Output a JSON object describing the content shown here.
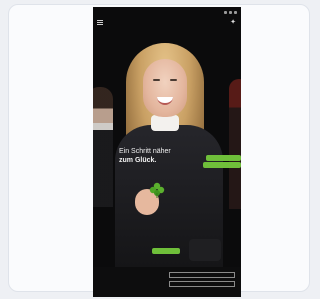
{
  "app": {
    "status_bar": {
      "time": "",
      "battery": ""
    },
    "brand_icon_name": "brand-logo-icon",
    "menu_icon_name": "menu-icon"
  },
  "hero": {
    "headline_line1": "Ein Schritt näher",
    "headline_line2": "zum Glück.",
    "chip_1": "",
    "chip_2": "",
    "chip_3": ""
  },
  "consent": {
    "text": "",
    "button_primary": "",
    "button_secondary": ""
  },
  "colors": {
    "accent_green": "#6fbf3a",
    "background_dark": "#0b0b0c",
    "page_bg": "#eef0f4"
  }
}
